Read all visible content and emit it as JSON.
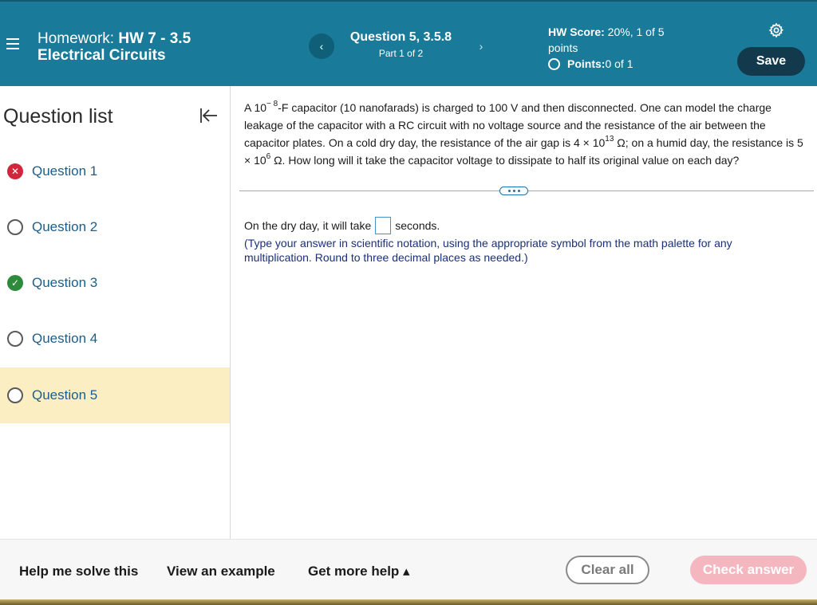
{
  "header": {
    "title_prefix": "Homework: ",
    "title_bold": "HW 7 - 3.5",
    "title_line2": "Electrical Circuits",
    "question_title": "Question 5, 3.5.8",
    "question_part": "Part 1 of 2",
    "hw_score_label": "HW Score:",
    "hw_score_value": " 20%, 1 of 5",
    "hw_score_line2": "points",
    "points_label": "Points:",
    "points_value": " 0 of 1",
    "save_label": "Save",
    "prev_icon": "‹",
    "next_icon": "›",
    "colors": {
      "header_bg": "#1a7a99",
      "save_bg": "#123a4c"
    }
  },
  "sidebar": {
    "title": "Question list",
    "items": [
      {
        "label": "Question 1",
        "status": "wrong"
      },
      {
        "label": "Question 2",
        "status": "empty"
      },
      {
        "label": "Question 3",
        "status": "correct"
      },
      {
        "label": "Question 4",
        "status": "empty"
      },
      {
        "label": "Question 5",
        "status": "empty",
        "active": true
      }
    ]
  },
  "question": {
    "p1_a": "A 10",
    "p1_exp": "− 8",
    "p1_b": "-F capacitor (10 nanofarads) is charged to 100 V and then disconnected. One can model the charge leakage of the capacitor with a RC circuit with no voltage source and the resistance of the air between the capacitor plates. On a cold dry day, the resistance of the air gap is 4 × 10",
    "p1_exp2": "13",
    "p1_c": " Ω; on a humid day, the resistance is 5 × 10",
    "p1_exp3": "6",
    "p1_d": " Ω. How long will it take the capacitor voltage to dissipate to half its original value on each day?",
    "answer_prefix": "On the dry day, it will take",
    "answer_suffix": "seconds.",
    "hint": "(Type your answer in scientific notation, using the appropriate symbol from the math palette for any multiplication. Round to three decimal places as needed.)"
  },
  "footer": {
    "help_label": "Help me solve this",
    "example_label": "View an example",
    "more_help_label": "Get more help ▴",
    "clear_label": "Clear all",
    "check_label": "Check answer"
  }
}
